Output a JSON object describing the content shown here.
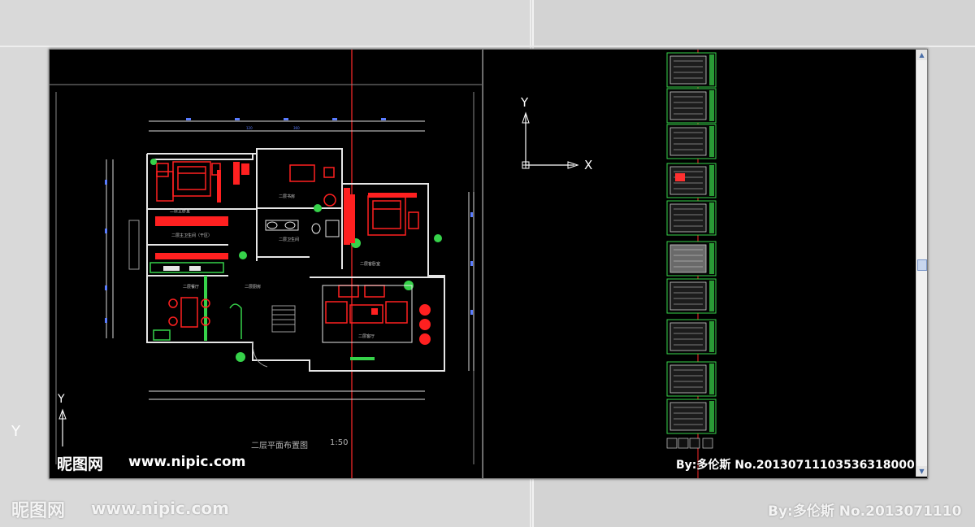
{
  "left_drawing": {
    "title": "二层平面布置图",
    "scale": "1:50",
    "ucs_y": "Y",
    "rooms": [
      "二层主卧室",
      "二层书房",
      "二层卫生间",
      "二层客卧室",
      "二层客厅",
      "二层餐厅",
      "二层厨房",
      "二层主卫生间"
    ]
  },
  "right_drawing": {
    "ucs_y": "Y",
    "ucs_x": "X",
    "sheet_count": 10
  },
  "watermark": {
    "brand": "昵图网",
    "url": "www.nipic.com",
    "author": "By:多伦斯",
    "number": "No.20130711103536318000",
    "bg_number": "No.2013071110"
  },
  "background": {
    "ucs_y": "Y"
  },
  "colors": {
    "wall": "#e6e6e6",
    "furniture": "#ff2020",
    "green": "#36d24a",
    "dim": "#6a86ff",
    "centerline": "#ff3030"
  }
}
